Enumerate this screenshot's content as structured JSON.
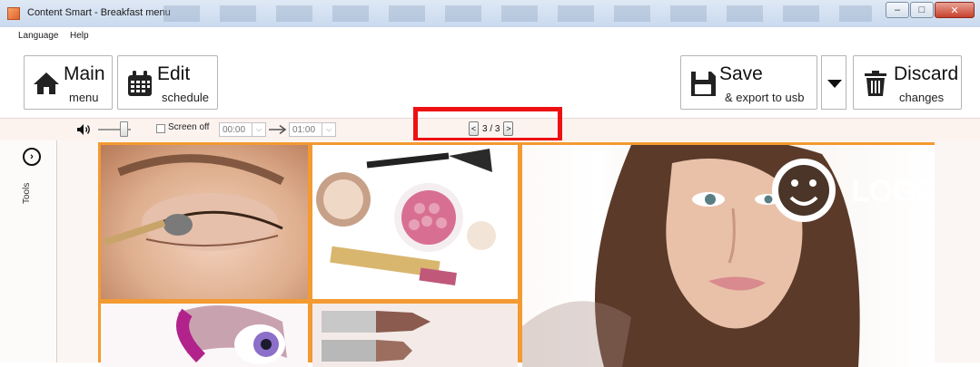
{
  "window": {
    "title": "Content Smart - Breakfast menu",
    "controls": {
      "minimize": "–",
      "maximize": "□",
      "close": "✕"
    }
  },
  "menubar": {
    "items": [
      "Language",
      "Help"
    ]
  },
  "toolbar": {
    "main_menu": {
      "title": "Main",
      "subtitle": "menu",
      "icon": "home-icon"
    },
    "edit_schedule": {
      "title": "Edit",
      "subtitle": "schedule",
      "icon": "calendar-icon"
    },
    "save": {
      "title": "Save",
      "subtitle": "& export to usb",
      "icon": "floppy-disk-icon"
    },
    "save_dropdown": {
      "icon": "chevron-down-icon"
    },
    "discard": {
      "title": "Discard",
      "subtitle": "changes",
      "icon": "trash-icon"
    }
  },
  "options": {
    "volume_icon": "speaker-icon",
    "volume_level": 0.8,
    "screen_off_label": "Screen off",
    "screen_off_checked": false,
    "time_from": "00:00",
    "time_to": "01:00",
    "arrow_icon": "right-arrow-icon",
    "pager": {
      "prev": "<",
      "text": "3 / 3",
      "next": ">"
    }
  },
  "tools": {
    "label": "Tools",
    "icon": "expand-chevron-icon"
  },
  "canvas": {
    "border_color": "#f39a32",
    "logo_text": "LOGO",
    "highlight_color": "#ee1111"
  }
}
